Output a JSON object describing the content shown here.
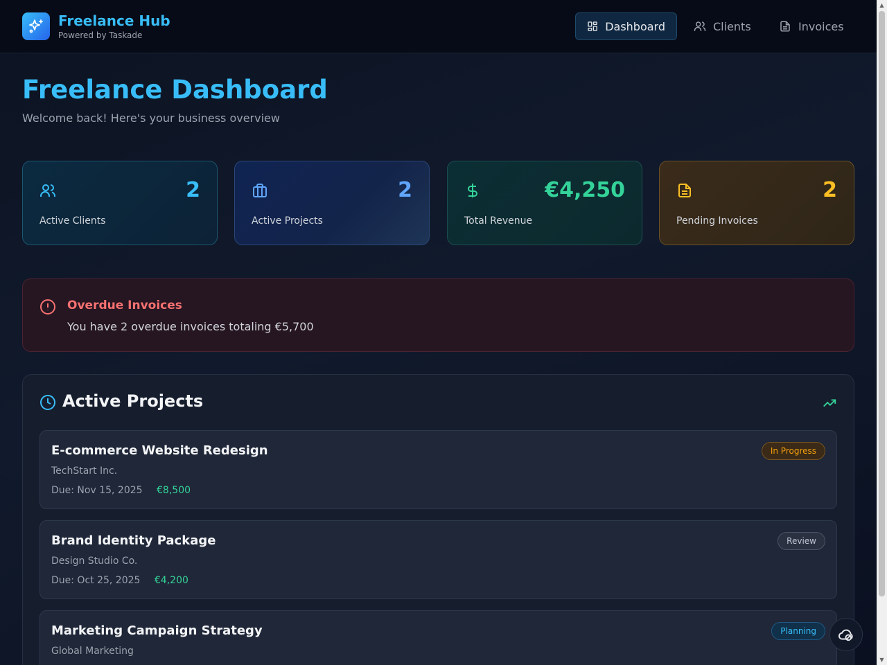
{
  "header": {
    "brand_title": "Freelance Hub",
    "brand_subtitle": "Powered by Taskade",
    "nav": [
      {
        "label": "Dashboard",
        "icon": "dashboard-icon",
        "active": true
      },
      {
        "label": "Clients",
        "icon": "users-icon",
        "active": false
      },
      {
        "label": "Invoices",
        "icon": "file-icon",
        "active": false
      }
    ]
  },
  "page": {
    "title": "Freelance Dashboard",
    "subtitle": "Welcome back! Here's your business overview"
  },
  "stats": [
    {
      "label": "Active Clients",
      "value": "2",
      "icon": "users-icon",
      "color": "#38bdf8"
    },
    {
      "label": "Active Projects",
      "value": "2",
      "icon": "briefcase-icon",
      "color": "#60a5fa"
    },
    {
      "label": "Total Revenue",
      "value": "€4,250",
      "icon": "dollar-icon",
      "color": "#34d399"
    },
    {
      "label": "Pending Invoices",
      "value": "2",
      "icon": "document-icon",
      "color": "#fbbf24"
    }
  ],
  "alert": {
    "title": "Overdue Invoices",
    "message": "You have 2 overdue invoices totaling €5,700"
  },
  "projects_panel": {
    "title": "Active Projects",
    "items": [
      {
        "title": "E-commerce Website Redesign",
        "client": "TechStart Inc.",
        "due": "Due: Nov 15, 2025",
        "amount": "€8,500",
        "status": "In Progress"
      },
      {
        "title": "Brand Identity Package",
        "client": "Design Studio Co.",
        "due": "Due: Oct 25, 2025",
        "amount": "€4,200",
        "status": "Review"
      },
      {
        "title": "Marketing Campaign Strategy",
        "client": "Global Marketing",
        "due": "",
        "amount": "",
        "status": "Planning"
      }
    ]
  },
  "colors": {
    "accent": "#38bdf8",
    "danger": "#f87171",
    "success": "#34d399",
    "warning": "#f59e0b"
  }
}
